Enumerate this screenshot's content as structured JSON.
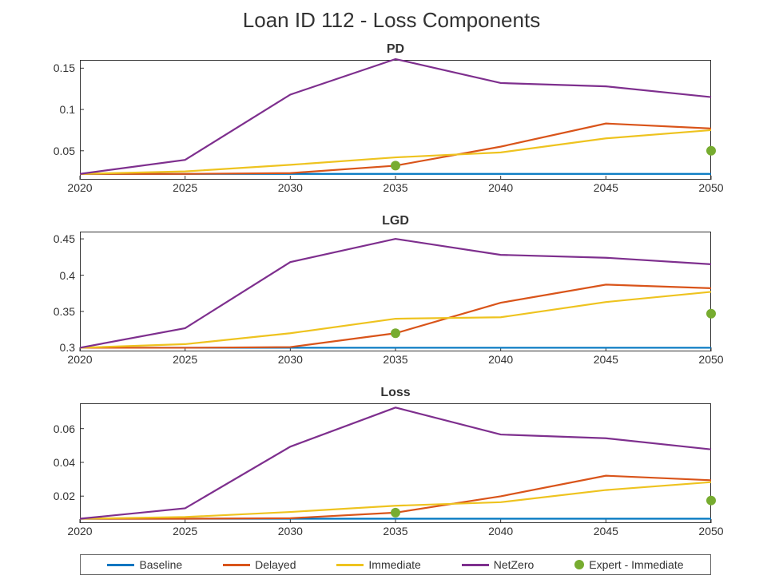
{
  "title": "Loan ID 112 - Loss Components",
  "colors": {
    "Baseline": "#0076c1",
    "Delayed": "#d9541a",
    "Immediate": "#eec31f",
    "NetZero": "#7e2f8e",
    "Expert": "#77ac30"
  },
  "legend": {
    "baseline": "Baseline",
    "delayed": "Delayed",
    "immediate": "Immediate",
    "netzero": "NetZero",
    "expert": "Expert - Immediate"
  },
  "chart_data": [
    {
      "title": "PD",
      "type": "line",
      "x": [
        2020,
        2025,
        2030,
        2035,
        2040,
        2045,
        2050
      ],
      "xlim": [
        2020,
        2050
      ],
      "ylim": [
        0.015,
        0.16
      ],
      "yticks": [
        0.05,
        0.1,
        0.15
      ],
      "ytick_labels": [
        "0.05",
        "0.1",
        "0.15"
      ],
      "xtick_labels": [
        "2020",
        "2025",
        "2030",
        "2035",
        "2040",
        "2045",
        "2050"
      ],
      "series": [
        {
          "name": "Baseline",
          "values": [
            0.022,
            0.022,
            0.022,
            0.022,
            0.022,
            0.022,
            0.022
          ]
        },
        {
          "name": "Delayed",
          "values": [
            0.022,
            0.022,
            0.023,
            0.032,
            0.055,
            0.083,
            0.077
          ]
        },
        {
          "name": "Immediate",
          "values": [
            0.022,
            0.025,
            0.033,
            0.042,
            0.048,
            0.065,
            0.075
          ]
        },
        {
          "name": "NetZero",
          "values": [
            0.022,
            0.039,
            0.118,
            0.161,
            0.132,
            0.128,
            0.115
          ]
        }
      ],
      "markers": [
        {
          "name": "Expert - Immediate",
          "x": 2035,
          "y": 0.032
        },
        {
          "name": "Expert - Immediate",
          "x": 2050,
          "y": 0.05
        }
      ]
    },
    {
      "title": "LGD",
      "type": "line",
      "x": [
        2020,
        2025,
        2030,
        2035,
        2040,
        2045,
        2050
      ],
      "xlim": [
        2020,
        2050
      ],
      "ylim": [
        0.295,
        0.46
      ],
      "yticks": [
        0.3,
        0.35,
        0.4,
        0.45
      ],
      "ytick_labels": [
        "0.3",
        "0.35",
        "0.4",
        "0.45"
      ],
      "xtick_labels": [
        "2020",
        "2025",
        "2030",
        "2035",
        "2040",
        "2045",
        "2050"
      ],
      "series": [
        {
          "name": "Baseline",
          "values": [
            0.3,
            0.3,
            0.3,
            0.3,
            0.3,
            0.3,
            0.3
          ]
        },
        {
          "name": "Delayed",
          "values": [
            0.3,
            0.3,
            0.301,
            0.32,
            0.362,
            0.387,
            0.382
          ]
        },
        {
          "name": "Immediate",
          "values": [
            0.3,
            0.305,
            0.32,
            0.34,
            0.342,
            0.363,
            0.377
          ]
        },
        {
          "name": "NetZero",
          "values": [
            0.3,
            0.327,
            0.418,
            0.45,
            0.428,
            0.424,
            0.415
          ]
        }
      ],
      "markers": [
        {
          "name": "Expert - Immediate",
          "x": 2035,
          "y": 0.32
        },
        {
          "name": "Expert - Immediate",
          "x": 2050,
          "y": 0.347
        }
      ]
    },
    {
      "title": "Loss",
      "type": "line",
      "x": [
        2020,
        2025,
        2030,
        2035,
        2040,
        2045,
        2050
      ],
      "xlim": [
        2020,
        2050
      ],
      "ylim": [
        0.004,
        0.075
      ],
      "yticks": [
        0.02,
        0.04,
        0.06
      ],
      "ytick_labels": [
        "0.02",
        "0.04",
        "0.06"
      ],
      "xtick_labels": [
        "2020",
        "2025",
        "2030",
        "2035",
        "2040",
        "2045",
        "2050"
      ],
      "series": [
        {
          "name": "Baseline",
          "values": [
            0.0066,
            0.0066,
            0.0066,
            0.0066,
            0.0066,
            0.0066,
            0.0066
          ]
        },
        {
          "name": "Delayed",
          "values": [
            0.0066,
            0.0066,
            0.0069,
            0.0102,
            0.0199,
            0.0321,
            0.0294
          ]
        },
        {
          "name": "Immediate",
          "values": [
            0.0066,
            0.0076,
            0.0106,
            0.0143,
            0.0164,
            0.0236,
            0.0283
          ]
        },
        {
          "name": "NetZero",
          "values": [
            0.0066,
            0.0128,
            0.0493,
            0.0725,
            0.0565,
            0.0543,
            0.0477
          ]
        }
      ],
      "markers": [
        {
          "name": "Expert - Immediate",
          "x": 2035,
          "y": 0.0102
        },
        {
          "name": "Expert - Immediate",
          "x": 2050,
          "y": 0.0174
        }
      ]
    }
  ]
}
